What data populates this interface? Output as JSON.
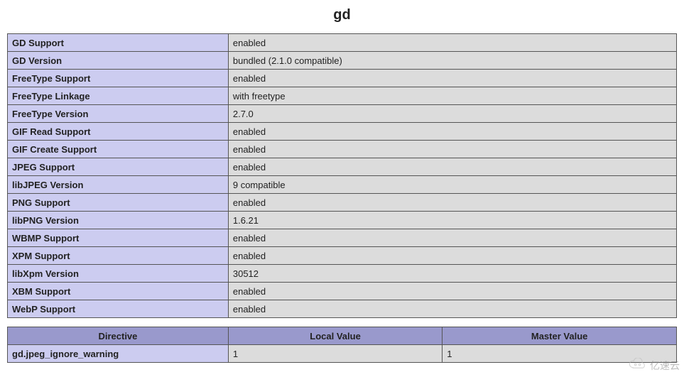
{
  "heading": "gd",
  "info_rows": [
    {
      "label": "GD Support",
      "value": "enabled"
    },
    {
      "label": "GD Version",
      "value": "bundled (2.1.0 compatible)"
    },
    {
      "label": "FreeType Support",
      "value": "enabled"
    },
    {
      "label": "FreeType Linkage",
      "value": "with freetype"
    },
    {
      "label": "FreeType Version",
      "value": "2.7.0"
    },
    {
      "label": "GIF Read Support",
      "value": "enabled"
    },
    {
      "label": "GIF Create Support",
      "value": "enabled"
    },
    {
      "label": "JPEG Support",
      "value": "enabled"
    },
    {
      "label": "libJPEG Version",
      "value": "9 compatible"
    },
    {
      "label": "PNG Support",
      "value": "enabled"
    },
    {
      "label": "libPNG Version",
      "value": "1.6.21"
    },
    {
      "label": "WBMP Support",
      "value": "enabled"
    },
    {
      "label": "XPM Support",
      "value": "enabled"
    },
    {
      "label": "libXpm Version",
      "value": "30512"
    },
    {
      "label": "XBM Support",
      "value": "enabled"
    },
    {
      "label": "WebP Support",
      "value": "enabled"
    }
  ],
  "config_headers": {
    "directive": "Directive",
    "local": "Local Value",
    "master": "Master Value"
  },
  "config_rows": [
    {
      "directive": "gd.jpeg_ignore_warning",
      "local": "1",
      "master": "1"
    }
  ],
  "watermark_text": "亿速云"
}
